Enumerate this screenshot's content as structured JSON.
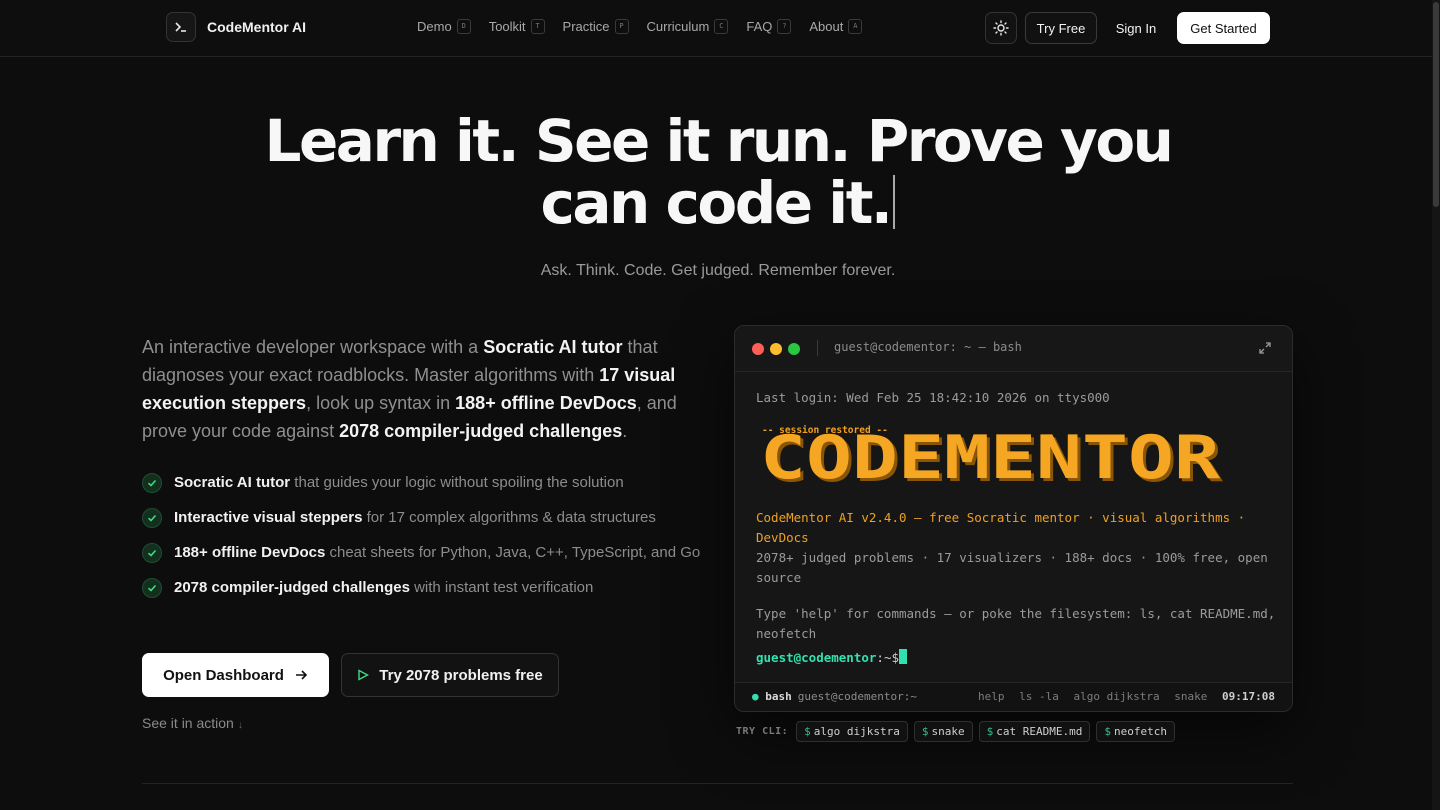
{
  "nav": {
    "brand": "CodeMentor AI",
    "links": [
      {
        "label": "Demo",
        "key": "D"
      },
      {
        "label": "Toolkit",
        "key": "T"
      },
      {
        "label": "Practice",
        "key": "P"
      },
      {
        "label": "Curriculum",
        "key": "C"
      },
      {
        "label": "FAQ",
        "key": "?"
      },
      {
        "label": "About",
        "key": "A"
      }
    ],
    "theme_icon": "sun-icon",
    "try_free": "Try Free",
    "sign_in": "Sign In",
    "get_started": "Get Started"
  },
  "hero": {
    "title_line1": "Learn it. See it run. Prove you",
    "title_line2": "can code it.",
    "tagline": "Ask. Think. Code. Get judged. Remember forever."
  },
  "intro": {
    "p1": "An interactive developer workspace with a ",
    "b1": "Socratic AI tutor",
    "p2": " that diagnoses your exact roadblocks. Master algorithms with ",
    "b2": "17 visual execution steppers",
    "p3": ", look up syntax in ",
    "b3": "188+ offline DevDocs",
    "p4": ", and prove your code against ",
    "b4": "2078 compiler-judged challenges",
    "p5": "."
  },
  "features": [
    {
      "bold": "Socratic AI tutor",
      "text": " that guides your logic without spoiling the solution"
    },
    {
      "bold": "Interactive visual steppers",
      "text": " for 17 complex algorithms & data structures"
    },
    {
      "bold": "188+ offline DevDocs",
      "text": " cheat sheets for Python, Java, C++, TypeScript, and Go"
    },
    {
      "bold": "2078 compiler-judged challenges",
      "text": " with instant test verification"
    }
  ],
  "cta": {
    "primary": "Open Dashboard",
    "secondary": "Try 2078 problems free",
    "see_action": "See it in action"
  },
  "terminal": {
    "title": "guest@codementor: ~ — bash",
    "last_login": "Last login: Wed Feb 25 18:42:10 2026 on ttys000",
    "session_restored": "-- session restored --",
    "ascii_text": "CODEMENTOR",
    "line_orange": "CodeMentor AI v2.4.0 — free Socratic mentor · visual algorithms · DevDocs",
    "line_stats": "2078+ judged problems · 17 visualizers · 188+ docs · 100% free, open source",
    "line_help": "Type 'help' for commands — or poke the filesystem: ls, cat README.md, neofetch",
    "prompt_user": "guest@codementor",
    "prompt_path": ":~$",
    "status": {
      "shell": "bash",
      "host": "guest@codementor:~",
      "hints": [
        "help",
        "ls -la",
        "algo dijkstra",
        "snake"
      ],
      "time": "09:17:08"
    }
  },
  "cli": {
    "label": "TRY CLI:",
    "commands": [
      "algo dijkstra",
      "snake",
      "cat README.md",
      "neofetch"
    ]
  },
  "colors": {
    "accent_green": "#33e0b0",
    "terminal_orange": "#f0a020",
    "mac_red": "#ff5f57",
    "mac_yellow": "#febc2e",
    "mac_green": "#28c840"
  }
}
